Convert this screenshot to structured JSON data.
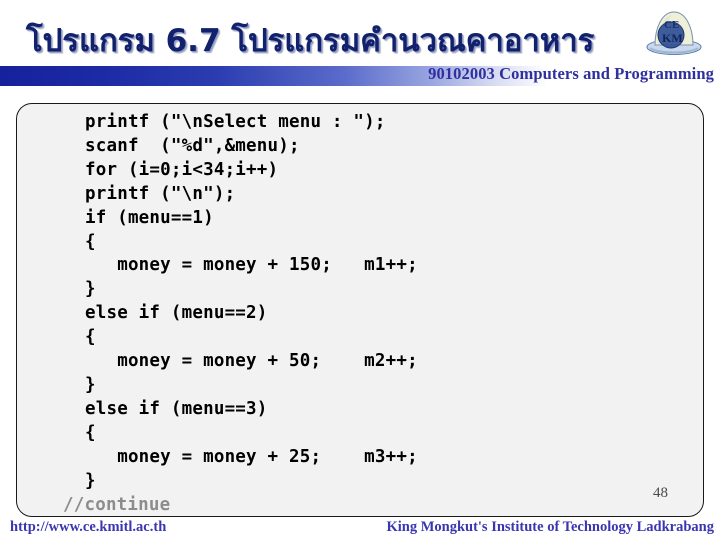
{
  "slide": {
    "title": "โปรแกรม  6.7 โปรแกรมคำนวณคาอาหาร",
    "course_banner": "90102003 Computers and Programming",
    "page_number": "48",
    "logo_alt": "ce-kmitl-logo",
    "colors": {
      "title_text": "#11216b",
      "banner_gradient_start": "#15229b",
      "banner_gradient_end": "#ffffff",
      "banner_text": "#2f2f9e",
      "code_background": "#f2f2f2",
      "code_border": "#1a1a1a",
      "code_text": "#000000",
      "comment_text": "#8c8c8c",
      "footer_text": "#3a36b0"
    }
  },
  "code": {
    "language": "c",
    "lines": [
      "printf (\"\\nSelect menu : \");",
      "scanf  (\"%d\",&menu);",
      "for (i=0;i<34;i++)",
      "printf (\"\\n\");",
      "if (menu==1)",
      "{",
      "   money = money + 150;   m1++;",
      "}",
      "else if (menu==2)",
      "{",
      "   money = money + 50;    m2++;",
      "}",
      "else if (menu==3)",
      "{",
      "   money = money + 25;    m3++;",
      "}"
    ],
    "trailing_comment": "//continue"
  },
  "footer": {
    "url": "http://www.ce.kmitl.ac.th",
    "institution": "King Mongkut's Institute of Technology Ladkrabang"
  }
}
